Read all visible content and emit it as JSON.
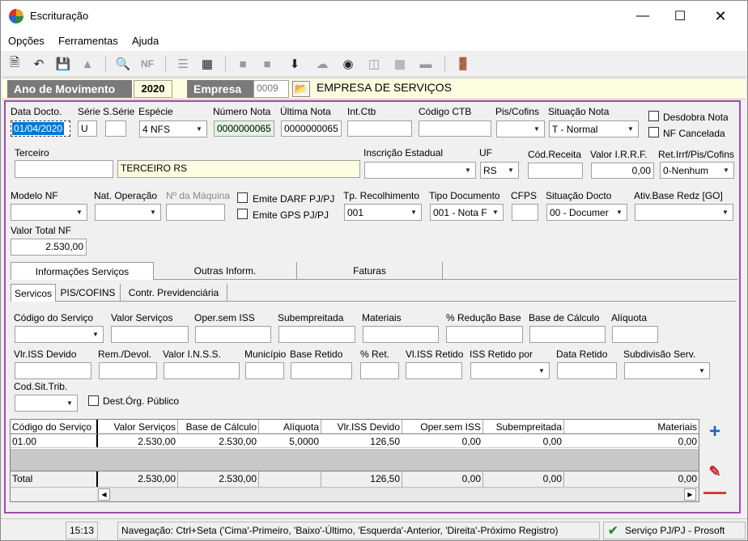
{
  "window": {
    "title": "Escrituração"
  },
  "menu": {
    "opcoes": "Opções",
    "ferramentas": "Ferramentas",
    "ajuda": "Ajuda"
  },
  "header": {
    "ano_label": "Ano de Movimento",
    "ano_value": "2020",
    "empresa_label": "Empresa",
    "empresa_code": "0009",
    "empresa_name": "EMPRESA DE SERVIÇOS"
  },
  "form": {
    "data_docto": {
      "label": "Data Docto.",
      "value": "01/04/2020"
    },
    "serie": {
      "label": "Série",
      "value": "U"
    },
    "sserie": {
      "label": "S.Série",
      "value": ""
    },
    "especie": {
      "label": "Espécie",
      "value": "4 NFS"
    },
    "numero_nota": {
      "label": "Número Nota",
      "value": "0000000065"
    },
    "ultima_nota": {
      "label": "Última Nota",
      "value": "0000000065"
    },
    "int_ctb": {
      "label": "Int.Ctb",
      "value": ""
    },
    "codigo_ctb": {
      "label": "Código CTB",
      "value": ""
    },
    "pis_cofins": {
      "label": "Pis/Cofins",
      "value": ""
    },
    "situacao_nota": {
      "label": "Situação Nota",
      "value": "T - Normal"
    },
    "desdobra_nota": {
      "label": "Desdobra Nota",
      "checked": false
    },
    "nf_cancelada": {
      "label": "NF Cancelada",
      "checked": false
    },
    "terceiro": {
      "label": "Terceiro",
      "code": "",
      "name": "TERCEIRO RS"
    },
    "inscricao_estadual": {
      "label": "Inscrição Estadual",
      "value": ""
    },
    "uf": {
      "label": "UF",
      "value": "RS"
    },
    "cod_receita": {
      "label": "Cód.Receita",
      "value": ""
    },
    "valor_irrf": {
      "label": "Valor I.R.R.F.",
      "value": "0,00"
    },
    "ret_irrf": {
      "label": "Ret.Irrf/Pis/Cofins",
      "value": "0-Nenhum"
    },
    "modelo_nf": {
      "label": "Modelo NF",
      "value": ""
    },
    "nat_operacao": {
      "label": "Nat. Operação",
      "value": ""
    },
    "num_maquina": {
      "label": "Nº da Máquina",
      "value": ""
    },
    "emite_darf": {
      "label": "Emite DARF PJ/PJ",
      "checked": false
    },
    "emite_gps": {
      "label": "Emite GPS PJ/PJ",
      "checked": false
    },
    "tp_recolhimento": {
      "label": "Tp. Recolhimento",
      "value": "001"
    },
    "tipo_documento": {
      "label": "Tipo Documento",
      "value": "001 - Nota F"
    },
    "cfps": {
      "label": "CFPS",
      "value": ""
    },
    "situacao_docto": {
      "label": "Situação Docto",
      "value": "00 - Documer"
    },
    "ativ_base_redz": {
      "label": "Ativ.Base Redz [GO]",
      "value": ""
    },
    "valor_total_nf": {
      "label": "Valor Total NF",
      "value": "2.530,00"
    }
  },
  "tabs": [
    "Informações Serviços",
    "Outras Inform.",
    "Faturas"
  ],
  "subtabs": [
    "Servicos",
    "PIS/COFINS",
    "Contr. Previdenciária"
  ],
  "servico": {
    "codigo_servico": "Código do Serviço",
    "valor_servicos": "Valor Serviços",
    "oper_sem_iss": "Oper.sem ISS",
    "subempreitada": "Subempreitada",
    "materiais": "Materiais",
    "reducao_base": "% Redução Base",
    "base_calculo": "Base de Cálculo",
    "aliquota": "Alíquota",
    "vlr_iss_devido": "Vlr.ISS Devido",
    "rem_devol": "Rem./Devol.",
    "valor_inss": "Valor I.N.S.S.",
    "municipio": "Município",
    "base_retido": "Base Retido",
    "pct_ret": "% Ret.",
    "vl_iss_retido": "Vl.ISS Retido",
    "iss_retido_por": "ISS Retido por",
    "data_retido": "Data Retido",
    "subdivisao_serv": "Subdivisão Serv.",
    "cod_sit_trib": "Cod.Sit.Trib.",
    "dest_org_publico": "Dest.Órg. Público"
  },
  "grid": {
    "columns": [
      "Código do Serviço",
      "Valor Serviços",
      "Base de Cálculo",
      "Alíquota",
      "Vlr.ISS Devido",
      "Oper.sem ISS",
      "Subempreitada",
      "Materiais"
    ],
    "rows": [
      [
        "01.00",
        "2.530,00",
        "2.530,00",
        "5,0000",
        "126,50",
        "0,00",
        "0,00",
        "0,00"
      ]
    ],
    "total": [
      "Total",
      "2.530,00",
      "2.530,00",
      "",
      "126,50",
      "0,00",
      "0,00",
      "0,00"
    ]
  },
  "status": {
    "time": "15:13",
    "help": "Navegação: Ctrl+Seta ('Cima'-Primeiro, 'Baixo'-Último, 'Esquerda'-Anterior, 'Direita'-Próximo Registro)",
    "module": "Serviço PJ/PJ - Prosoft"
  }
}
